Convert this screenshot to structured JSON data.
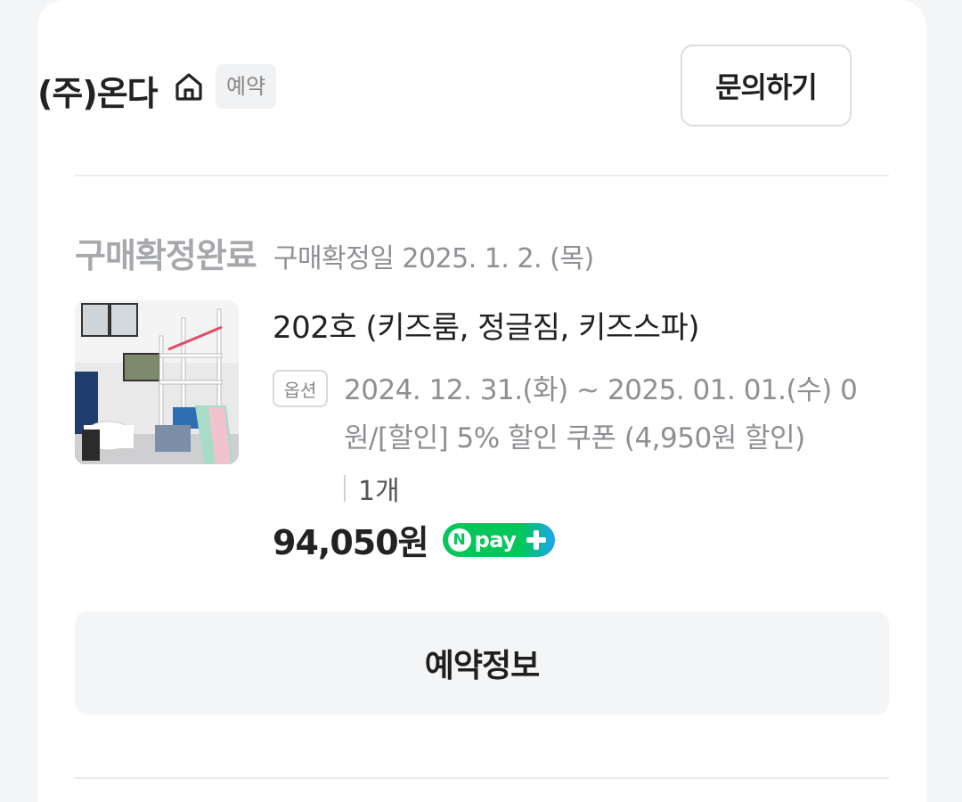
{
  "header": {
    "store_name": "(주)온다",
    "badge": "예약",
    "inquiry_label": "문의하기"
  },
  "order": {
    "status": "구매확정완료",
    "confirm_date": "구매확정일 2025. 1. 2. (목)"
  },
  "product": {
    "title": "202호 (키즈룸, 정글짐, 키즈스파)",
    "option_label": "옵션",
    "option_text": "2024. 12. 31.(화) ~ 2025. 01. 01.(수) 0원/[할인] 5% 할인 쿠폰 (4,950원 할인)",
    "quantity": "1개",
    "price": "94,050원",
    "npay_n": "N",
    "npay_label": "pay"
  },
  "actions": {
    "reservation_info_label": "예약정보"
  },
  "icons": {
    "home": "home-icon",
    "npay_plus": "plus-icon"
  },
  "colors": {
    "npay_green": "#03c75a",
    "npay_blue": "#1ea4f1",
    "status_gray": "#a7a8ab"
  }
}
